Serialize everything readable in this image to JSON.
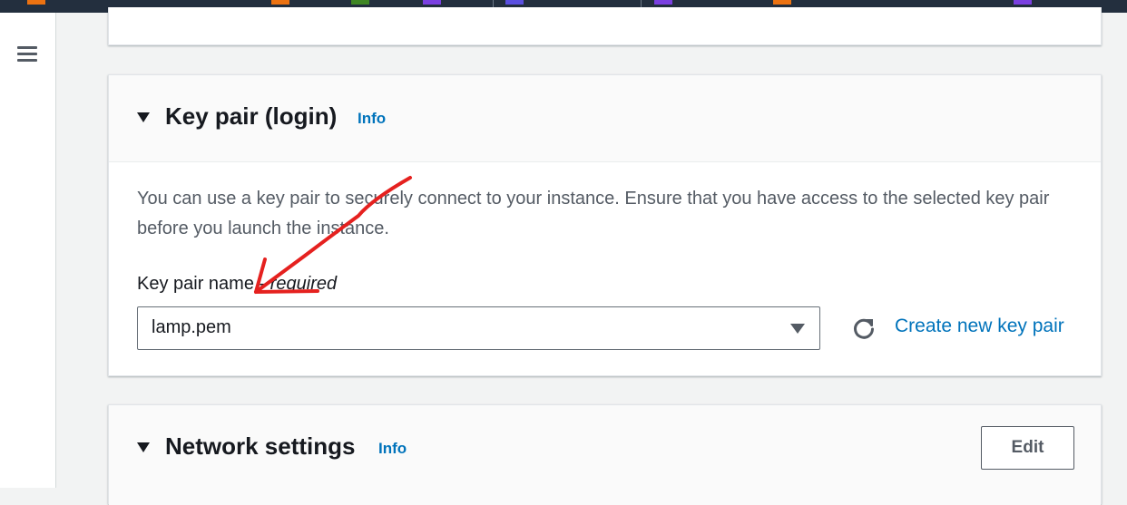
{
  "colors": {
    "topbar": "#232f3e",
    "link": "#0073bb",
    "annotation": "#e5211f",
    "chips": [
      "#ec7211",
      "#ec7211",
      "#3f8624",
      "#7a3fe0",
      "#5a4fe0",
      "#7a3fe0",
      "#ec7211",
      "#7a3fe0"
    ]
  },
  "key_pair": {
    "title": "Key pair (login)",
    "info": "Info",
    "description": "You can use a key pair to securely connect to your instance. Ensure that you have access to the selected key pair before you launch the instance.",
    "field_label": "Key pair name - ",
    "field_required": "required",
    "selected_value": "lamp.pem",
    "create_link": "Create new key pair"
  },
  "network": {
    "title": "Network settings",
    "info": "Info",
    "edit_label": "Edit"
  }
}
